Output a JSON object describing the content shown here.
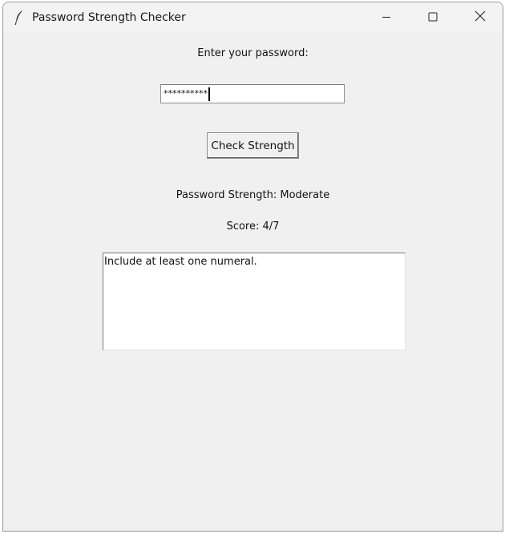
{
  "window": {
    "title": "Password Strength Checker",
    "icon": "feather-icon"
  },
  "titlebar_controls": [
    "minimize-icon",
    "maximize-icon",
    "close-icon"
  ],
  "form": {
    "prompt_label": "Enter your password:",
    "password_value": "**********",
    "check_button_label": "Check Strength"
  },
  "result": {
    "strength_text": "Password Strength: Moderate",
    "score_text": "Score: 4/7",
    "feedback_text": "Include at least one numeral."
  }
}
